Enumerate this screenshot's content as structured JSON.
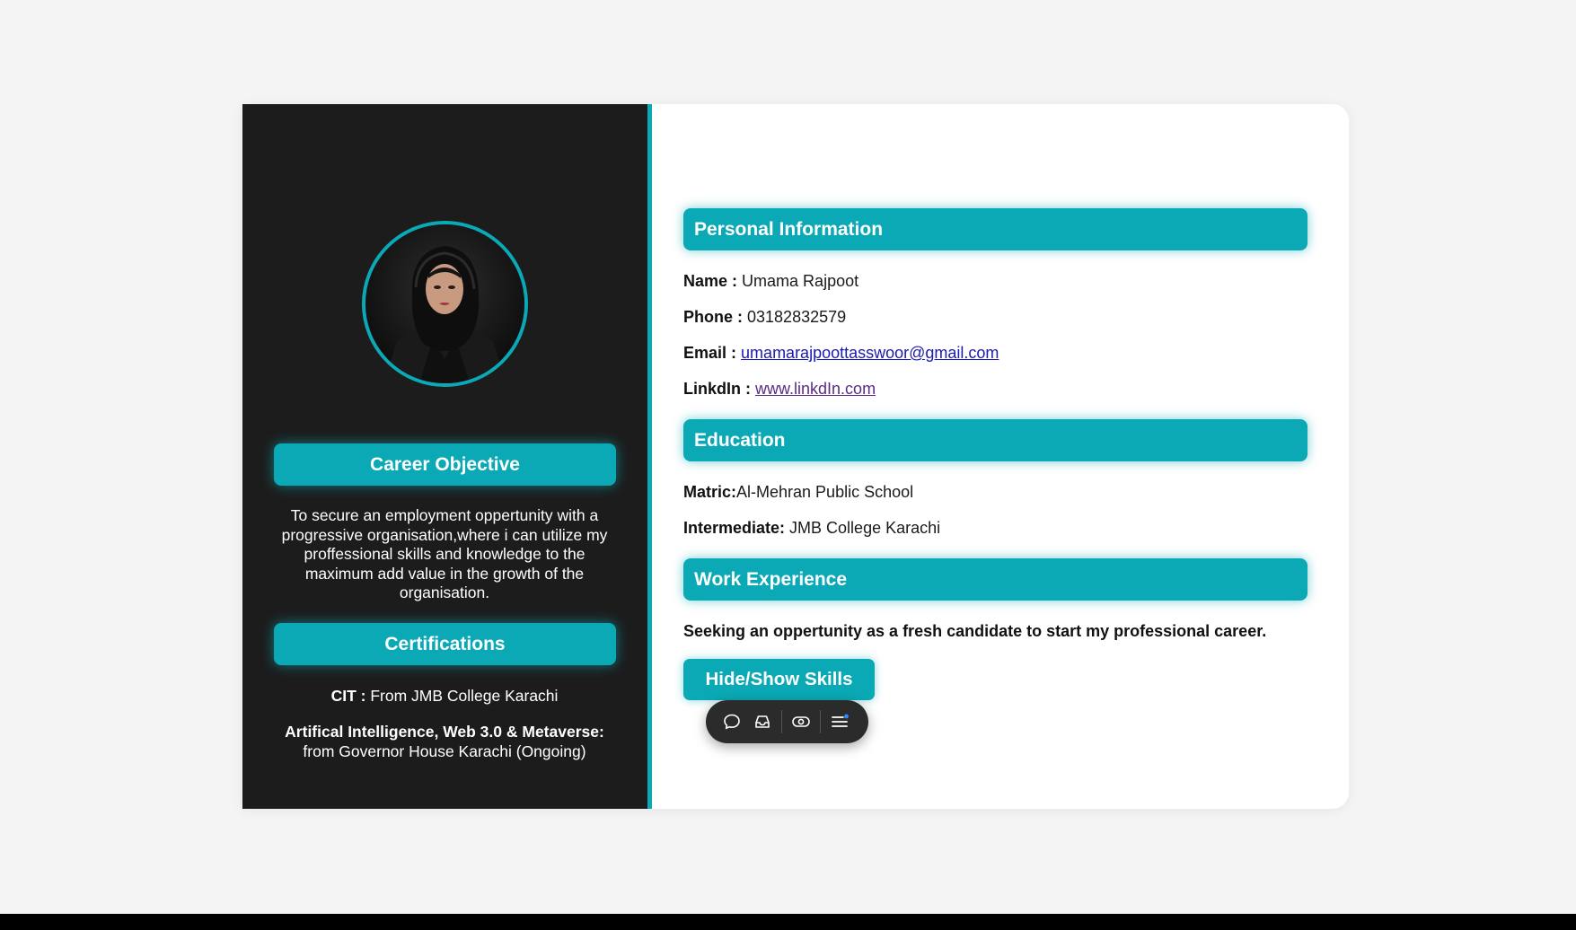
{
  "left": {
    "career_heading": "Career Objective",
    "career_text": "To secure an employment oppertunity with a progressive organisation,where i can utilize my proffessional skills and knowledge to the maximum add value in the growth of the organisation.",
    "cert_heading": "Certifications",
    "cert_1_key": "CIT :",
    "cert_1_value": "From JMB College Karachi",
    "cert_2_key": "Artifical Intelligence, Web 3.0 & Metaverse:",
    "cert_2_value": "from Governor House Karachi (Ongoing)"
  },
  "personal": {
    "heading": "Personal Information",
    "name_key": "Name :",
    "name_value": "Umama Rajpoot",
    "phone_key": "Phone :",
    "phone_value": "03182832579",
    "email_key": "Email :",
    "email_value": "umamarajpoottasswoor@gmail.com",
    "linkedin_key": "LinkdIn :",
    "linkedin_value": "www.linkdIn.com"
  },
  "education": {
    "heading": "Education",
    "matric_key": "Matric:",
    "matric_value": "Al-Mehran Public School",
    "inter_key": "Intermediate:",
    "inter_value": "JMB College Karachi"
  },
  "work": {
    "heading": "Work Experience",
    "text": "Seeking an oppertunity as a fresh candidate to start my professional career."
  },
  "skills_button": "Hide/Show Skills",
  "toolbar": {
    "icons": [
      "comment-icon",
      "inbox-icon",
      "eye-icon",
      "menu-icon"
    ],
    "accent": "#2f8cff"
  },
  "colors": {
    "accent": "#0aa9b5",
    "sidebar_bg": "#1c1c1c",
    "page_bg": "#f4f4f4"
  }
}
